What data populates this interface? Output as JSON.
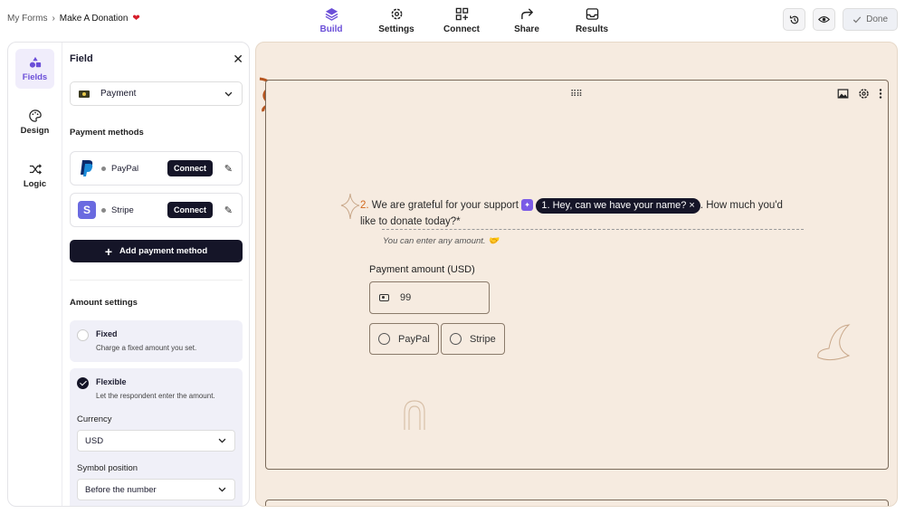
{
  "breadcrumb": {
    "root": "My Forms",
    "separator": "›",
    "current": "Make A Donation",
    "heart": "❤"
  },
  "nav": {
    "tabs": [
      {
        "label": "Build",
        "icon": "layers-icon",
        "active": true
      },
      {
        "label": "Settings",
        "icon": "gear-icon",
        "active": false
      },
      {
        "label": "Connect",
        "icon": "grid-plus-icon",
        "active": false
      },
      {
        "label": "Share",
        "icon": "share-arrow-icon",
        "active": false
      },
      {
        "label": "Results",
        "icon": "inbox-icon",
        "active": false
      }
    ]
  },
  "topright": {
    "done_label": "Done"
  },
  "rail": {
    "items": [
      {
        "label": "Fields",
        "icon": "shapes-icon",
        "active": true
      },
      {
        "label": "Design",
        "icon": "palette-icon",
        "active": false
      },
      {
        "label": "Logic",
        "icon": "shuffle-icon",
        "active": false
      }
    ]
  },
  "field_panel": {
    "title": "Field",
    "type_select": "Payment",
    "payment_methods_heading": "Payment methods",
    "methods": [
      {
        "name": "PayPal",
        "action": "Connect"
      },
      {
        "name": "Stripe",
        "action": "Connect"
      }
    ],
    "add_method_label": "Add payment method",
    "amount_settings_heading": "Amount settings",
    "options": [
      {
        "title": "Fixed",
        "desc": "Charge a fixed amount you set.",
        "checked": false
      },
      {
        "title": "Flexible",
        "desc": "Let the respondent enter the amount.",
        "checked": true
      }
    ],
    "currency_label": "Currency",
    "currency_value": "USD",
    "symbol_label": "Symbol position",
    "symbol_value": "Before the number"
  },
  "form": {
    "question_number": "2.",
    "question_before": "We are grateful for your support",
    "recall_pill": "1. Hey, can we have your name?",
    "question_after": ". How much you'd like to donate today?",
    "required_mark": "*",
    "hint": "You can enter any amount. 🤝",
    "amount_label": "Payment amount (USD)",
    "amount_value": "99",
    "choices": [
      "PayPal",
      "Stripe"
    ]
  },
  "colors": {
    "accent": "#6b4fd8",
    "dark": "#151528",
    "canvas": "#f6ebe0"
  }
}
